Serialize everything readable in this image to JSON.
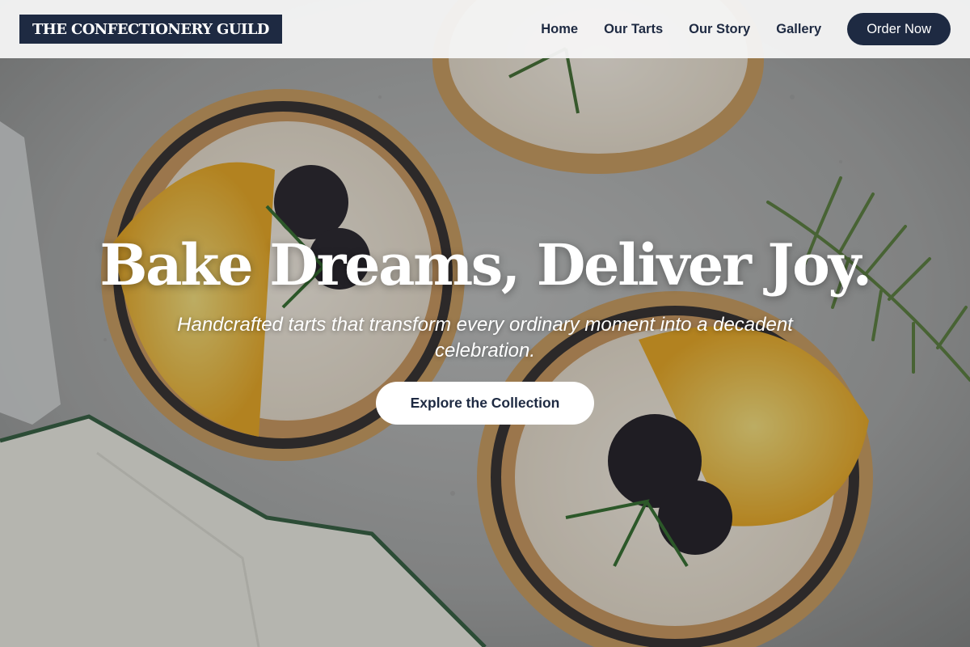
{
  "header": {
    "logo": "THE CONFECTIONERY GUILD",
    "nav": [
      "Home",
      "Our Tarts",
      "Our Story",
      "Gallery"
    ],
    "order_button": "Order Now"
  },
  "hero": {
    "headline": "Bake Dreams, Deliver Joy.",
    "tagline": "Handcrafted tarts that transform every ordinary moment into a decadent celebration.",
    "cta": "Explore the Collection"
  },
  "colors": {
    "brand_navy": "#1e2a42",
    "header_bg": "#f5f5f5",
    "cta_bg": "#ffffff"
  }
}
